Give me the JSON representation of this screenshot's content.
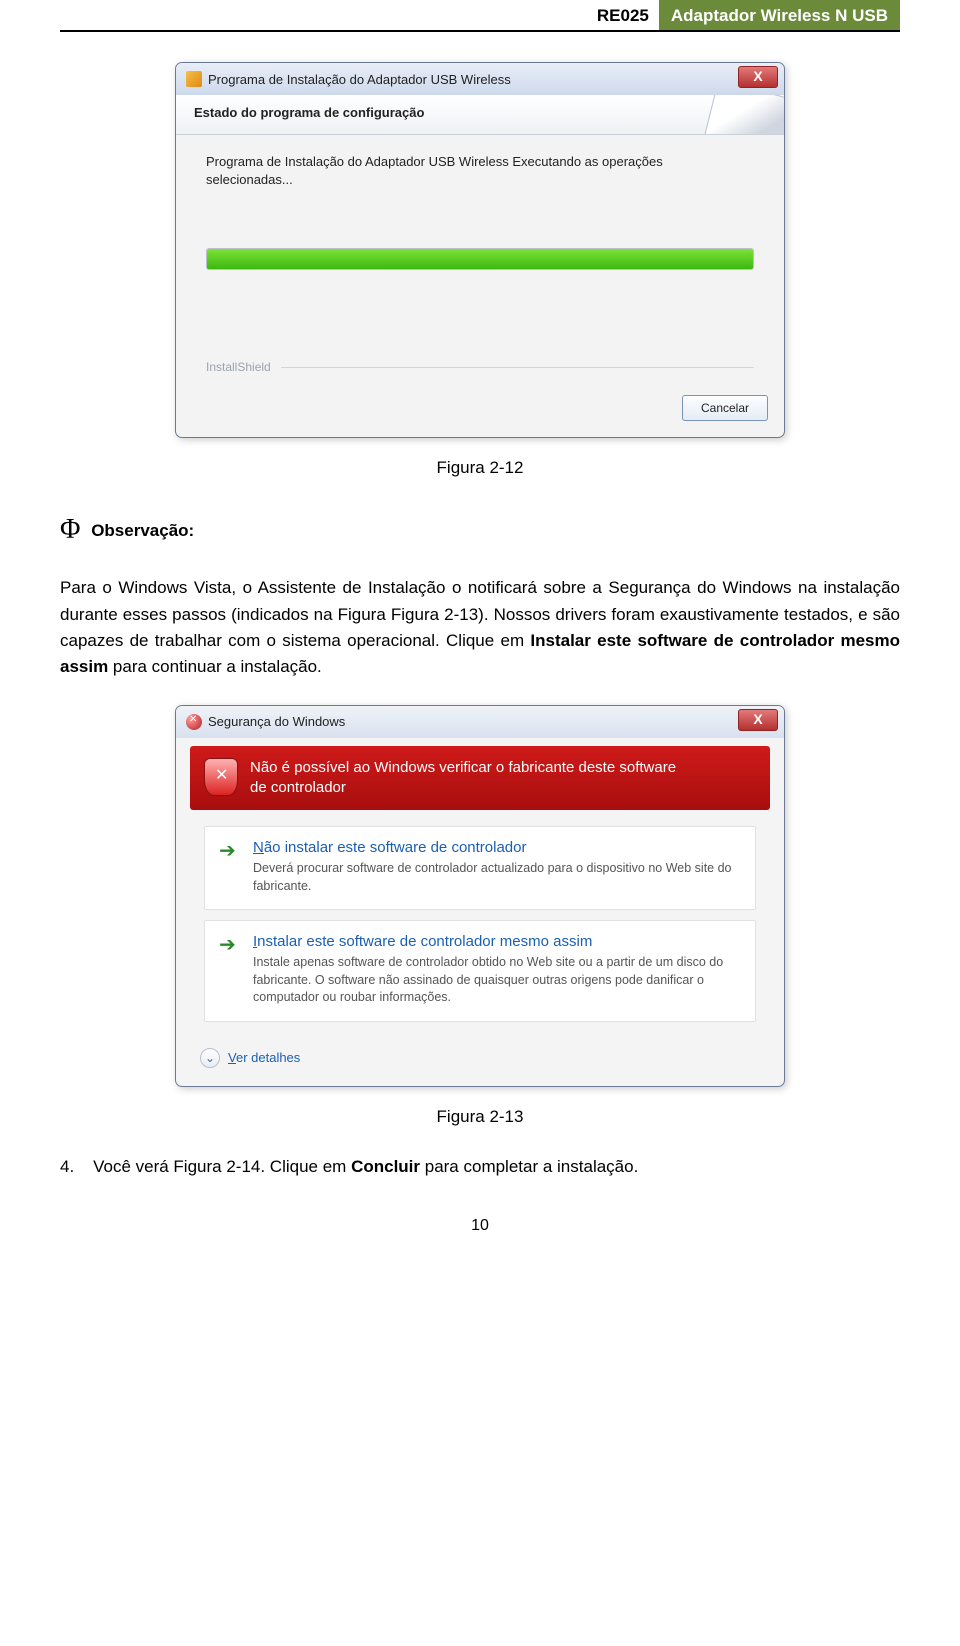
{
  "header": {
    "code": "RE025",
    "product": "Adaptador Wireless N USB"
  },
  "installer": {
    "title": "Programa de Instalação do Adaptador USB Wireless",
    "banner_title": "Estado do programa de configuração",
    "body_line1": "Programa de Instalação do Adaptador USB Wireless Executando as operações",
    "body_line2": "selecionadas...",
    "installshield": "InstallShield",
    "cancel": "Cancelar",
    "close_x": "X"
  },
  "fig1_caption": "Figura 2-12",
  "obs_symbol": "Φ",
  "obs_label": "Observação:",
  "para1_a": "Para o Windows Vista, o Assistente de Instalação o notificará sobre a Segurança do Windows na instalação durante esses passos (indicados na Figura ",
  "para1_figref": "Figura 2-13",
  "para1_b": "). Nossos drivers foram exaustivamente testados, e são capazes de trabalhar com o sistema operacional. Clique em ",
  "para1_bold": "Instalar este software de controlador mesmo assim",
  "para1_c": " para continuar a instalação.",
  "security": {
    "title": "Segurança do Windows",
    "close_x": "X",
    "banner_l1": "Não é possível ao Windows verificar o fabricante deste software",
    "banner_l2": "de controlador",
    "opt1_title_pre": "N",
    "opt1_title_rest": "ão instalar este software de controlador",
    "opt1_desc": "Deverá procurar software de controlador actualizado para o dispositivo no Web site do fabricante.",
    "opt2_title_pre": "I",
    "opt2_title_rest": "nstalar este software de controlador mesmo assim",
    "opt2_desc": "Instale apenas software de controlador obtido no Web site ou a partir de um disco do fabricante. O software não assinado de quaisquer outras origens pode danificar o computador ou roubar informações.",
    "details_pre": "V",
    "details_rest": "er detalhes"
  },
  "fig2_caption": "Figura 2-13",
  "item4_num": "4.",
  "item4_a": "Você verá ",
  "item4_figref": "Figura 2-14",
  "item4_b": ". Clique em ",
  "item4_bold": "Concluir",
  "item4_c": " para completar a instalação.",
  "page_number": "10"
}
